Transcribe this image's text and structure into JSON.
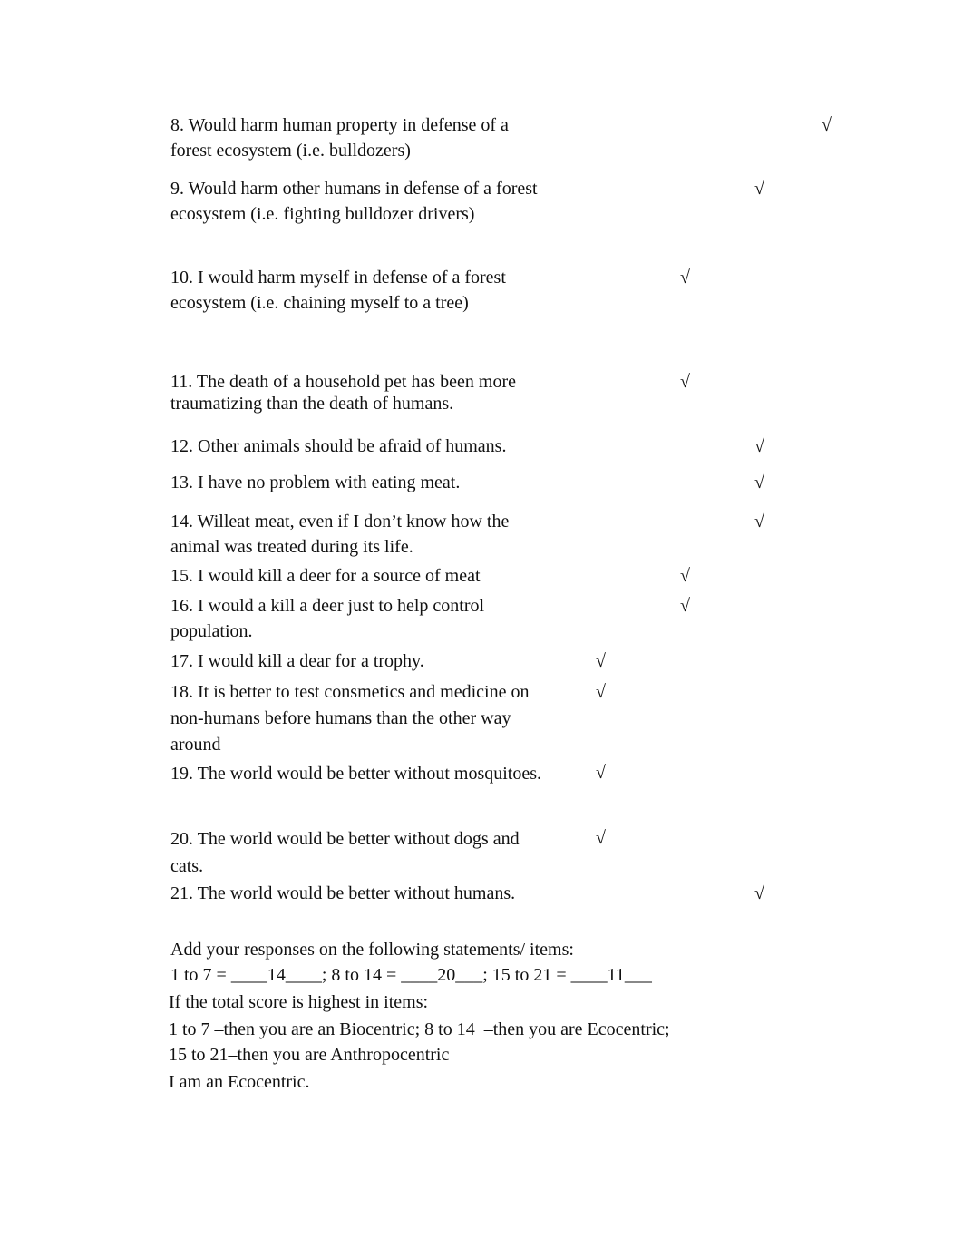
{
  "items": [
    {
      "text": "8. Would harm human property in defense of a forest ecosystem (i.e. bulldozers)",
      "response_column": 4
    },
    {
      "text": "9. Would harm other humans in defense of a forest ecosystem (i.e. fighting bulldozer drivers)",
      "response_column": 3
    },
    {
      "text": "10. I would harm myself in defense of a forest ecosystem (i.e. chaining myself to a tree)",
      "response_column": 2
    },
    {
      "text": "11. The death of a household pet has been more traumatizing than the death of humans.",
      "response_column": 2
    },
    {
      "text": "12. Other animals should be afraid of humans.",
      "response_column": 3
    },
    {
      "text": "13. I have no problem with eating meat.",
      "response_column": 3
    },
    {
      "text": "14. Willeat meat, even if I don’t know how the animal was treated during its life.",
      "response_column": 3
    },
    {
      "text": "15. I would kill a deer for a source of meat",
      "response_column": 2
    },
    {
      "text": "16. I would a kill a deer just to help control population.",
      "response_column": 2
    },
    {
      "text": "17. I would kill a dear for a trophy.",
      "response_column": 1
    },
    {
      "text": "18. It is better to test consmetics and medicine on non-humans before humans than the other way around",
      "response_column": 1
    },
    {
      "text": "19. The world would be better without mosquitoes.",
      "response_column": 1
    },
    {
      "text": "20. The world would be better without dogs and cats.",
      "response_column": 1
    },
    {
      "text": "21. The world would be better without humans.",
      "response_column": 3
    }
  ],
  "check_glyph": "√",
  "summary": {
    "instruction": "Add your responses on the following statements/ items:",
    "totals": "1 to 7 = ____14____; 8 to 14 = ____20___; 15 to 21 = ____11___",
    "condition": "If the total score is highest in items:",
    "key_line1": "1 to 7 –then you are an Biocentric; 8 to 14  –then you are Ecocentric;",
    "key_line2": "15 to 21–then you are Anthropocentric",
    "result": "I am an Ecocentric."
  }
}
